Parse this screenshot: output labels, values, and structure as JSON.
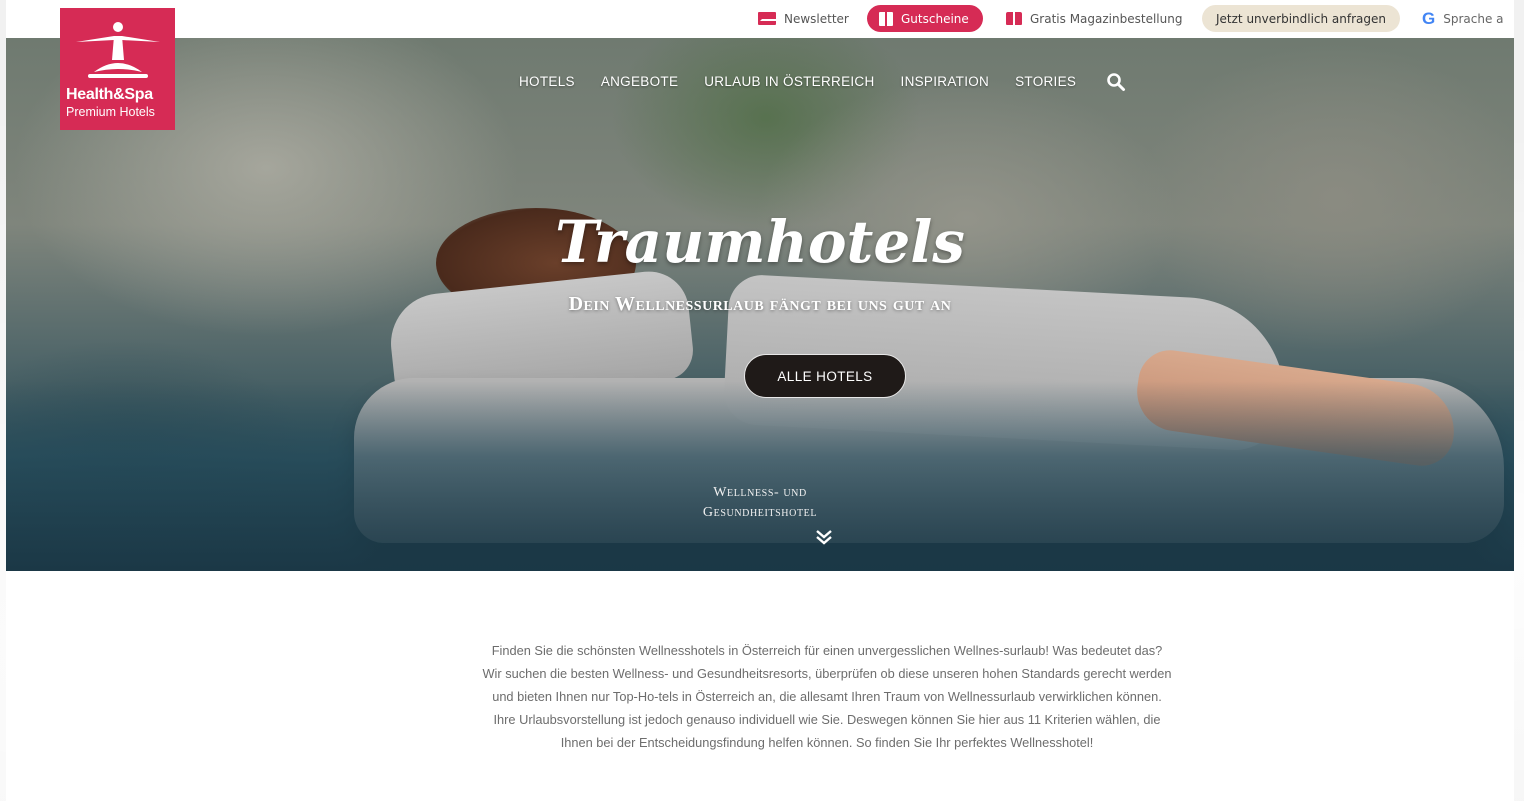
{
  "topbar": {
    "newsletter_label": "Newsletter",
    "gutscheine_label": "Gutscheine",
    "magazin_label": "Gratis Magazinbestellung",
    "anfragen_label": "Jetzt unverbindlich anfragen",
    "sprache_label": "Sprache a"
  },
  "logo": {
    "name": "Health&Spa",
    "subtitle": "Premium Hotels"
  },
  "nav": {
    "items": [
      "HOTELS",
      "ANGEBOTE",
      "URLAUB IN ÖSTERREICH",
      "INSPIRATION",
      "STORIES"
    ]
  },
  "hero": {
    "title": "Traumhotels",
    "subtitle": "Dein Wellnessurlaub fängt bei uns gut an",
    "button_label": "ALLE HOTELS",
    "caption_line1": "Wellness- und",
    "caption_line2": "Gesundheitshotel"
  },
  "intro": {
    "text": "Finden Sie die schönsten Wellnesshotels in Österreich für einen unvergesslichen Wellnes-surlaub! Was bedeutet das? Wir suchen die besten Wellness- und Gesundheitsresorts, überprüfen ob diese unseren hohen Standards gerecht werden und bieten Ihnen nur Top-Ho-tels in Österreich an, die allesamt Ihren Traum von Wellnessurlaub verwirklichen können. Ihre Urlaubsvorstellung ist jedoch genauso individuell wie Sie. Deswegen können Sie hier aus 11 Kriterien wählen, die Ihnen bei der Entscheidungsfindung helfen können. So finden Sie Ihr perfektes Wellnesshotel!"
  },
  "colors": {
    "brand": "#d62b55",
    "button_dark": "#1f1a18",
    "anfragen_bg": "#ece4d4"
  },
  "icons": {
    "newsletter": "mail-icon",
    "gutscheine": "gift-icon",
    "magazin": "book-icon",
    "sprache": "google-icon",
    "search": "search-icon",
    "scroll": "double-chevron-down-icon",
    "logo": "yoga-figure-icon"
  }
}
